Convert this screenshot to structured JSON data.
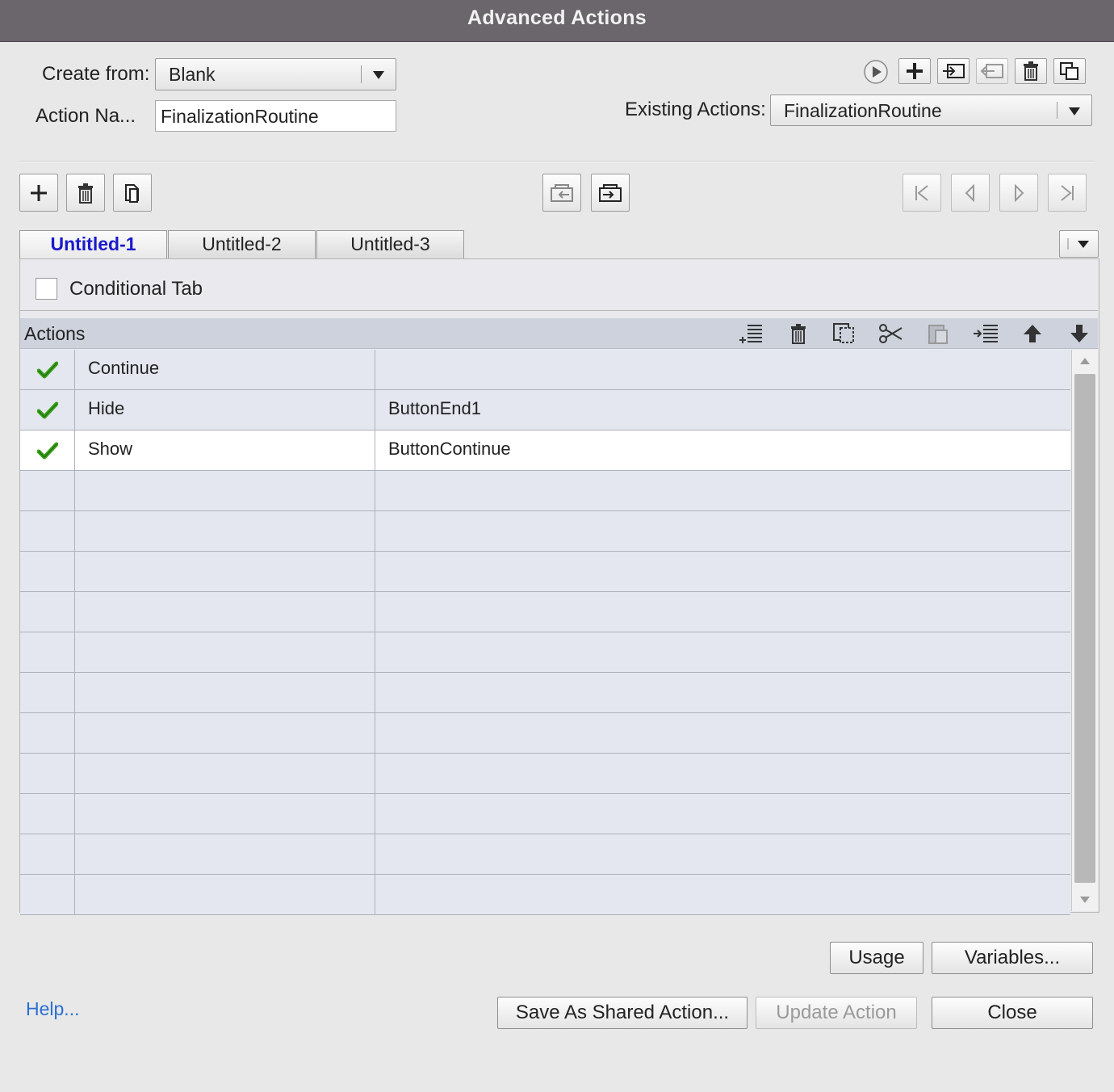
{
  "window": {
    "title": "Advanced Actions"
  },
  "form": {
    "create_from_label": "Create from:",
    "create_from_value": "Blank",
    "action_name_label": "Action Na...",
    "action_name_value": "FinalizationRoutine",
    "existing_actions_label": "Existing Actions:",
    "existing_actions_value": "FinalizationRoutine"
  },
  "top_toolbar": {
    "icons": [
      "preview-play-icon",
      "create-action-icon",
      "import-icon",
      "export-icon",
      "delete-action-icon",
      "duplicate-action-icon"
    ]
  },
  "decision_toolbar": {
    "icons": [
      "add-decision-icon",
      "delete-decision-icon",
      "duplicate-decision-icon",
      "import-decision-icon",
      "export-decision-icon",
      "first-icon",
      "previous-icon",
      "next-icon",
      "last-icon"
    ]
  },
  "tabs": [
    "Untitled-1",
    "Untitled-2",
    "Untitled-3"
  ],
  "active_tab": "Untitled-1",
  "conditional_tab": {
    "label": "Conditional Tab",
    "checked": false
  },
  "actions": {
    "header": "Actions",
    "header_icons": [
      "insert-row-icon",
      "delete-row-icon",
      "copy-row-icon",
      "cut-icon",
      "paste-icon",
      "indent-row-icon",
      "move-up-icon",
      "move-down-icon"
    ],
    "rows": [
      {
        "enabled": true,
        "action": "Continue",
        "target": ""
      },
      {
        "enabled": true,
        "action": "Hide",
        "target": "ButtonEnd1"
      },
      {
        "enabled": true,
        "action": "Show",
        "target": "ButtonContinue"
      },
      {
        "enabled": false,
        "action": "",
        "target": ""
      },
      {
        "enabled": false,
        "action": "",
        "target": ""
      },
      {
        "enabled": false,
        "action": "",
        "target": ""
      },
      {
        "enabled": false,
        "action": "",
        "target": ""
      },
      {
        "enabled": false,
        "action": "",
        "target": ""
      },
      {
        "enabled": false,
        "action": "",
        "target": ""
      },
      {
        "enabled": false,
        "action": "",
        "target": ""
      },
      {
        "enabled": false,
        "action": "",
        "target": ""
      },
      {
        "enabled": false,
        "action": "",
        "target": ""
      },
      {
        "enabled": false,
        "action": "",
        "target": ""
      },
      {
        "enabled": false,
        "action": "",
        "target": ""
      }
    ],
    "selected_row": 2
  },
  "buttons": {
    "usage": "Usage",
    "variables": "Variables...",
    "help": "Help...",
    "save_shared": "Save As Shared Action...",
    "update_action": "Update Action",
    "close": "Close"
  },
  "colors": {
    "title_bar": "#6a666b",
    "active_tab": "#1a1acc",
    "check": "#3aa11a",
    "link": "#2a6fd4"
  }
}
